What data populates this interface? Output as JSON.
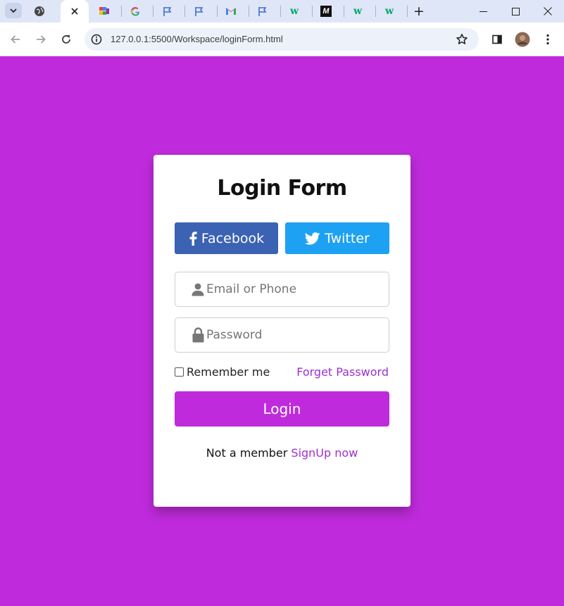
{
  "browser": {
    "tabs": [
      {
        "icon": "globe-icon"
      },
      {
        "icon": "close-icon",
        "active": true
      },
      {
        "icon": "colorful-app-icon"
      },
      {
        "icon": "google-icon"
      },
      {
        "icon": "flag-icon"
      },
      {
        "icon": "flag-icon"
      },
      {
        "icon": "gmail-icon"
      },
      {
        "icon": "flag-icon"
      },
      {
        "icon": "w3schools-icon",
        "label": "w"
      },
      {
        "icon": "m-logo-icon",
        "label": "M"
      },
      {
        "icon": "w3schools-icon",
        "label": "w"
      },
      {
        "icon": "w3schools-icon",
        "label": "w"
      }
    ],
    "new_tab_label": "+",
    "url": "127.0.0.1:5500/Workspace/loginForm.html",
    "accent": "#dfe6f7"
  },
  "page": {
    "background": "#bf2bdc",
    "title": "Login Form",
    "facebook_label": "Facebook",
    "twitter_label": "Twitter",
    "email_placeholder": "Email or Phone",
    "password_placeholder": "Password",
    "remember_label": "Remember me",
    "forgot_label": "Forget Password",
    "login_label": "Login",
    "signup_prefix": "Not a member",
    "signup_link": "SignUp now",
    "colors": {
      "facebook": "#3b62b3",
      "twitter": "#1da1f2",
      "link": "#a02ed2",
      "button": "#bf2bdc"
    }
  }
}
